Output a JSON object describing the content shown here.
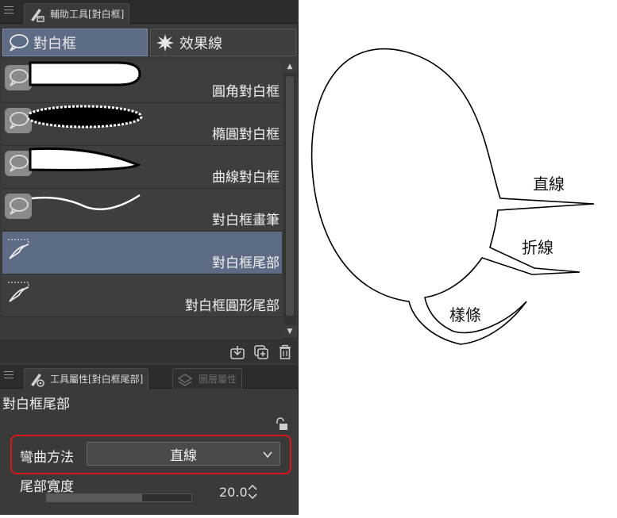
{
  "top_panel": {
    "tab_label": "輔助工具[對白框]"
  },
  "groups": [
    {
      "label": "對白框",
      "icon": "speech-balloon-icon",
      "selected": true
    },
    {
      "label": "效果線",
      "icon": "burst-icon",
      "selected": false
    }
  ],
  "subtools": [
    {
      "label": "圓角對白框",
      "icon": "speech-balloon-icon",
      "selected": false
    },
    {
      "label": "橢圓對白框",
      "icon": "speech-balloon-icon",
      "selected": false
    },
    {
      "label": "曲線對白框",
      "icon": "speech-balloon-icon",
      "selected": false
    },
    {
      "label": "對白框畫筆",
      "icon": "speech-balloon-icon",
      "selected": false
    },
    {
      "label": "對白框尾部",
      "icon": "balloon-tail-icon",
      "selected": true
    },
    {
      "label": "對白框圓形尾部",
      "icon": "balloon-tail-icon",
      "selected": false
    }
  ],
  "bottom_panel": {
    "tab_label": "工具屬性[對白框尾部]",
    "tab2_label": "圖層屬性",
    "title": "對白框尾部",
    "curve_method_label": "彎曲方法",
    "curve_method_value": "直線",
    "tail_width_label": "尾部寬度",
    "tail_width_value": "20.0",
    "tail_width_fraction": 0.66
  },
  "diagram": {
    "labels": [
      "直線",
      "折線",
      "樣條"
    ]
  },
  "colors": {
    "panel_bg": "#3a3a3a",
    "selected_bg": "#5e6b85",
    "highlight": "#d9141b"
  }
}
